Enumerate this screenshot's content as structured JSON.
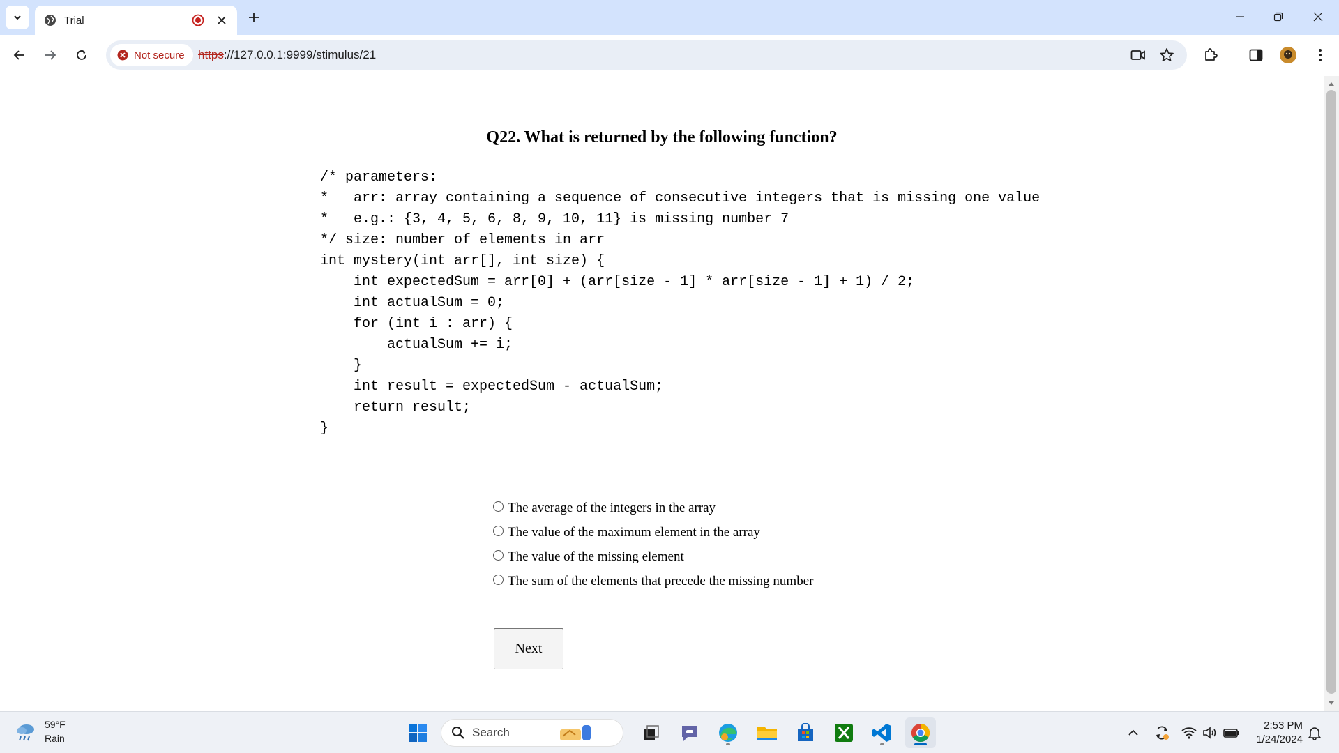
{
  "browser": {
    "tab": {
      "title": "Trial"
    },
    "omnibox": {
      "security_label": "Not secure",
      "url_scheme": "https",
      "url_rest": "://127.0.0.1:9999/stimulus/21"
    }
  },
  "page": {
    "question": "Q22. What is returned by the following function?",
    "code_lines": [
      "/* parameters:",
      "*   arr: array containing a sequence of consecutive integers that is missing one value",
      "*   e.g.: {3, 4, 5, 6, 8, 9, 10, 11} is missing number 7",
      "*/ size: number of elements in arr",
      "int mystery(int arr[], int size) {",
      "    int expectedSum = arr[0] + (arr[size - 1] * arr[size - 1] + 1) / 2;",
      "    int actualSum = 0;",
      "    for (int i : arr) {",
      "        actualSum += i;",
      "    }",
      "    int result = expectedSum - actualSum;",
      "    return result;",
      "}"
    ],
    "options": [
      "The average of the integers in the array",
      "The value of the maximum element in the array",
      "The value of the missing element",
      "The sum of the elements that precede the missing number"
    ],
    "next_label": "Next"
  },
  "taskbar": {
    "weather_temp": "59°F",
    "weather_desc": "Rain",
    "search_placeholder": "Search",
    "time": "2:53 PM",
    "date": "1/24/2024"
  }
}
